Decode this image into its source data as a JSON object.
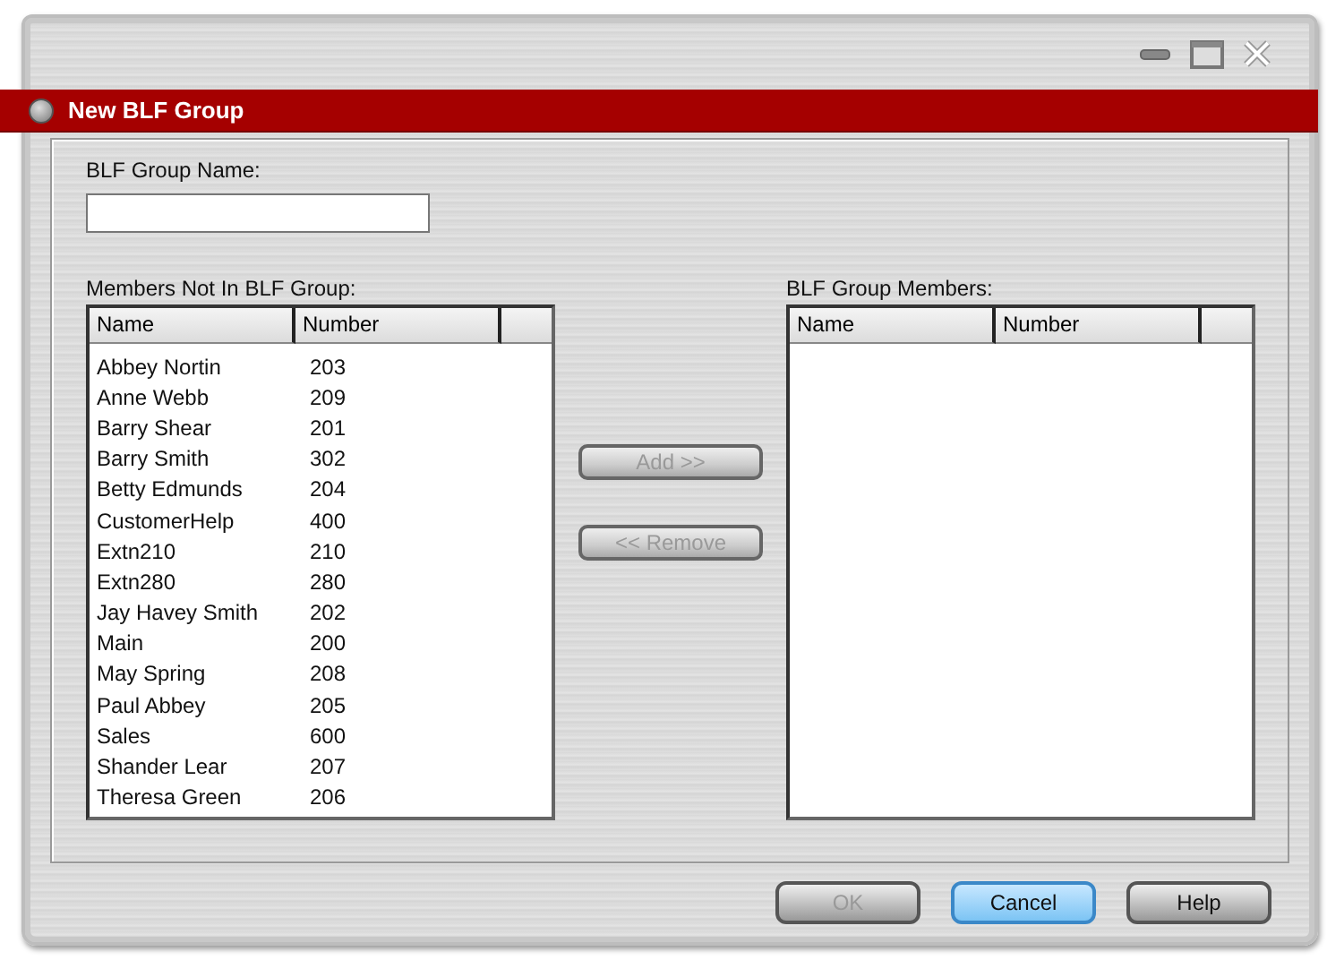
{
  "window": {
    "title": "New BLF Group"
  },
  "group_name": {
    "label": "BLF Group Name:"
  },
  "available": {
    "label": "Members Not In BLF Group:",
    "columns": [
      "Name",
      "Number"
    ],
    "rows": [
      {
        "name": "Abbey Nortin",
        "number": "203"
      },
      {
        "name": "Anne Webb",
        "number": "209"
      },
      {
        "name": "Barry Shear",
        "number": "201"
      },
      {
        "name": "Barry Smith",
        "number": "302"
      },
      {
        "name": "Betty Edmunds",
        "number": "204"
      },
      {
        "name": "CustomerHelp",
        "number": "400"
      },
      {
        "name": "Extn210",
        "number": "210"
      },
      {
        "name": "Extn280",
        "number": "280"
      },
      {
        "name": "Jay Havey Smith",
        "number": "202"
      },
      {
        "name": "Main",
        "number": "200"
      },
      {
        "name": "May Spring",
        "number": "208"
      },
      {
        "name": "Paul Abbey",
        "number": "205"
      },
      {
        "name": "Sales",
        "number": "600"
      },
      {
        "name": "Shander Lear",
        "number": "207"
      },
      {
        "name": "Theresa Green",
        "number": "206"
      }
    ]
  },
  "members": {
    "label": "BLF Group Members:",
    "columns": [
      "Name",
      "Number"
    ]
  },
  "move_buttons": [
    {
      "label": "Add >>",
      "disabled": true
    },
    {
      "label": "<< Remove",
      "disabled": true
    }
  ],
  "buttons": [
    {
      "label": "OK",
      "disabled": true,
      "default": false
    },
    {
      "label": "Cancel",
      "disabled": false,
      "default": true
    },
    {
      "label": "Help",
      "disabled": false,
      "default": false
    }
  ]
}
